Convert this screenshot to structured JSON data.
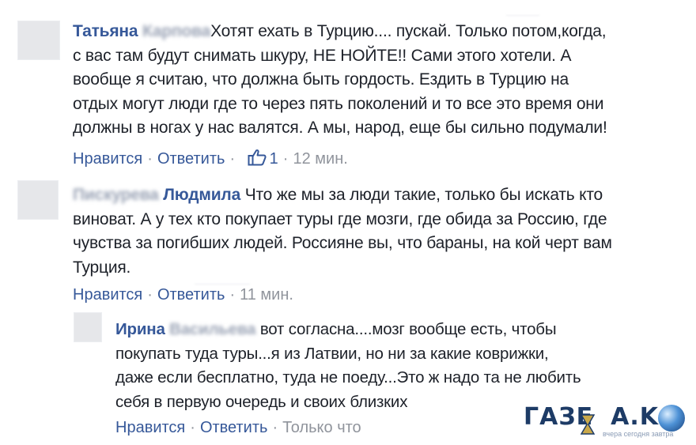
{
  "comments": [
    {
      "author_first": "Татьяна",
      "author_last": "Карпова",
      "lines": [
        "Хотят ехать в Турцию.... пускай. Только потом,когда,",
        "с вас там будут снимать шкуру, НЕ НОЙТЕ!! Сами этого хотели. А",
        "вообще я считаю, что должна быть гордость. Ездить в Турцию на",
        "отдых могут люди где то через пять поколений и то все это время они",
        "должны в ногах у нас валятся. А мы, народ, еще бы сильно подумали!"
      ],
      "like_label": "Нравится",
      "reply_label": "Ответить",
      "like_count": "1",
      "time": "12 мин."
    },
    {
      "author_first": "Пискурева",
      "author_last": "Людмила",
      "lines": [
        "Что же мы за люди такие, только бы искать кто",
        "виноват. А у тех кто покупает туры где мозги, где обида за Россию, где",
        "чувства за погибших людей. Россияне вы, что бараны, на кой черт вам",
        "Турция."
      ],
      "like_label": "Нравится",
      "reply_label": "Ответить",
      "time": "11 мин."
    },
    {
      "author_first": "Ирина",
      "author_last": "Васильева",
      "lines": [
        "вот согласна....мозг вообще есть, чтобы",
        "покупать туда туры...я из Латвии, но ни за какие коврижки,",
        "даже если бесплатно, туда не поеду...Это ж надо та не любить",
        "себя в первую очередь и своих близких"
      ],
      "like_label": "Нравится",
      "reply_label": "Ответить",
      "time": "Только что"
    }
  ],
  "watermark": {
    "brand_a": "ГАЗЕ",
    "brand_b": "А.KG",
    "tagline": "вчера сегодня завтра"
  },
  "colors": {
    "name": "#365899",
    "muted": "#90949c",
    "text": "#1d2129"
  }
}
